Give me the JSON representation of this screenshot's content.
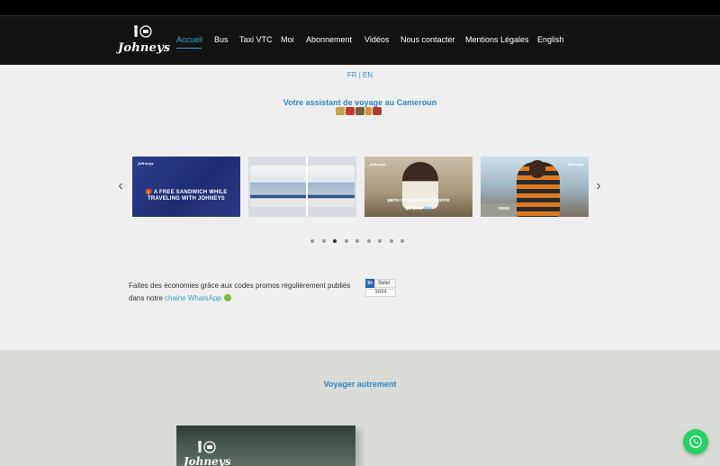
{
  "brand": {
    "name": "Johneys"
  },
  "nav": {
    "items": [
      {
        "label": "Accueil",
        "active": true
      },
      {
        "label": "Bus"
      },
      {
        "label": "Taxi VTC"
      },
      {
        "label": "Moi"
      },
      {
        "label": "Abonnement"
      },
      {
        "label": "Vidéos"
      },
      {
        "label": "Nous contacter"
      },
      {
        "label": "Mentions Légales"
      },
      {
        "label": "English"
      }
    ]
  },
  "lang_switch": {
    "text": "FR | EN"
  },
  "tagline": "Votre assistant de voyage au Cameroun",
  "carousel": {
    "slides": [
      {
        "mini_logo": "Johneys",
        "caption": "🎁 A FREE SANDWICH WHILE TRAVELING WITH JOHNEYS"
      },
      {
        "caption": ""
      },
      {
        "mini_logo": "Johneys",
        "caption_line1": "parce que, derrière n'importe",
        "caption_line2_a": "qui peut ",
        "caption_line2_b": "être"
      },
      {
        "mini_logo": "Johneys",
        "caption": "nous"
      }
    ],
    "dot_count": 9,
    "active_dot": 2
  },
  "promo": {
    "text_before": "Faites des économies grâce aux codes promos régulièrement publiés dans notre ",
    "link_text": "chaine WhatsApp"
  },
  "linkedin": {
    "logo_text": "in",
    "follow_label": "Suivi",
    "count": "3694"
  },
  "section2": {
    "title": "Voyager autrement",
    "card_logo": "Johneys"
  },
  "colors": {
    "accent": "#3aa7c9",
    "header_bg": "#121212",
    "whatsapp": "#25d366",
    "linkedin": "#2867b2"
  }
}
